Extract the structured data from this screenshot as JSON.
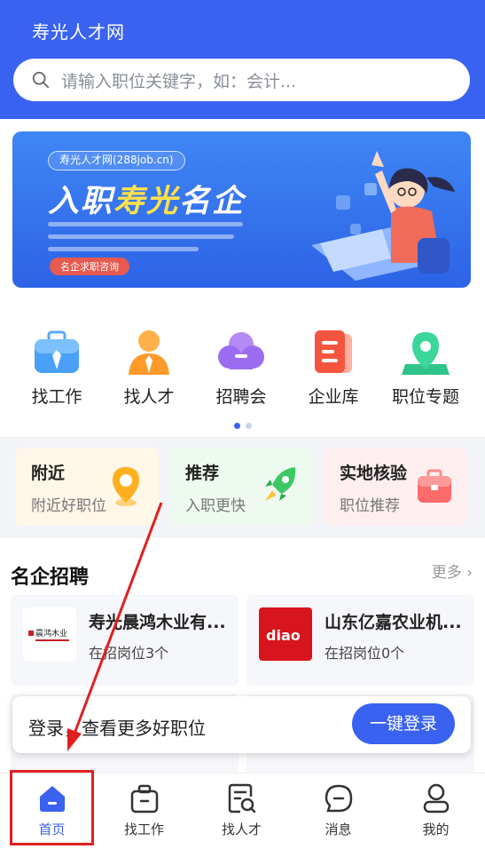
{
  "header": {
    "title": "寿光人才网",
    "search_placeholder": "请输入职位关键字，如：会计..."
  },
  "banner": {
    "site": "寿光人才网(288job.cn)",
    "headline_a": "入职",
    "headline_b": "寿光",
    "headline_c": "名企",
    "button": "名企求职咨询"
  },
  "quick_nav": [
    {
      "label": "找工作",
      "icon": "briefcase-icon"
    },
    {
      "label": "找人才",
      "icon": "person-icon"
    },
    {
      "label": "招聘会",
      "icon": "cloud-icon"
    },
    {
      "label": "企业库",
      "icon": "document-icon"
    },
    {
      "label": "职位专题",
      "icon": "map-pin-icon"
    }
  ],
  "cards": [
    {
      "title": "附近",
      "subtitle": "附近好职位",
      "icon": "location-pin-icon"
    },
    {
      "title": "推荐",
      "subtitle": "入职更快",
      "icon": "rocket-icon"
    },
    {
      "title": "实地核验",
      "subtitle": "职位推荐",
      "icon": "briefcase-icon"
    }
  ],
  "famous": {
    "title": "名企招聘",
    "more": "更多",
    "companies": [
      {
        "name": "寿光晨鸿木业有...",
        "jobs": "在招岗位3个",
        "logo_text": "晨鸿木业"
      },
      {
        "name": "山东亿嘉农业机...",
        "jobs": "在招岗位0个",
        "logo_text": "diao"
      }
    ]
  },
  "login": {
    "text": "登录，查看更多好职位",
    "button": "一键登录"
  },
  "tabs": [
    {
      "label": "首页",
      "icon": "home-icon",
      "active": true
    },
    {
      "label": "找工作",
      "icon": "briefcase-icon"
    },
    {
      "label": "找人才",
      "icon": "search-resume-icon"
    },
    {
      "label": "消息",
      "icon": "message-icon"
    },
    {
      "label": "我的",
      "icon": "profile-icon"
    }
  ],
  "colors": {
    "primary": "#3a62f0",
    "annotation": "#e02020"
  }
}
